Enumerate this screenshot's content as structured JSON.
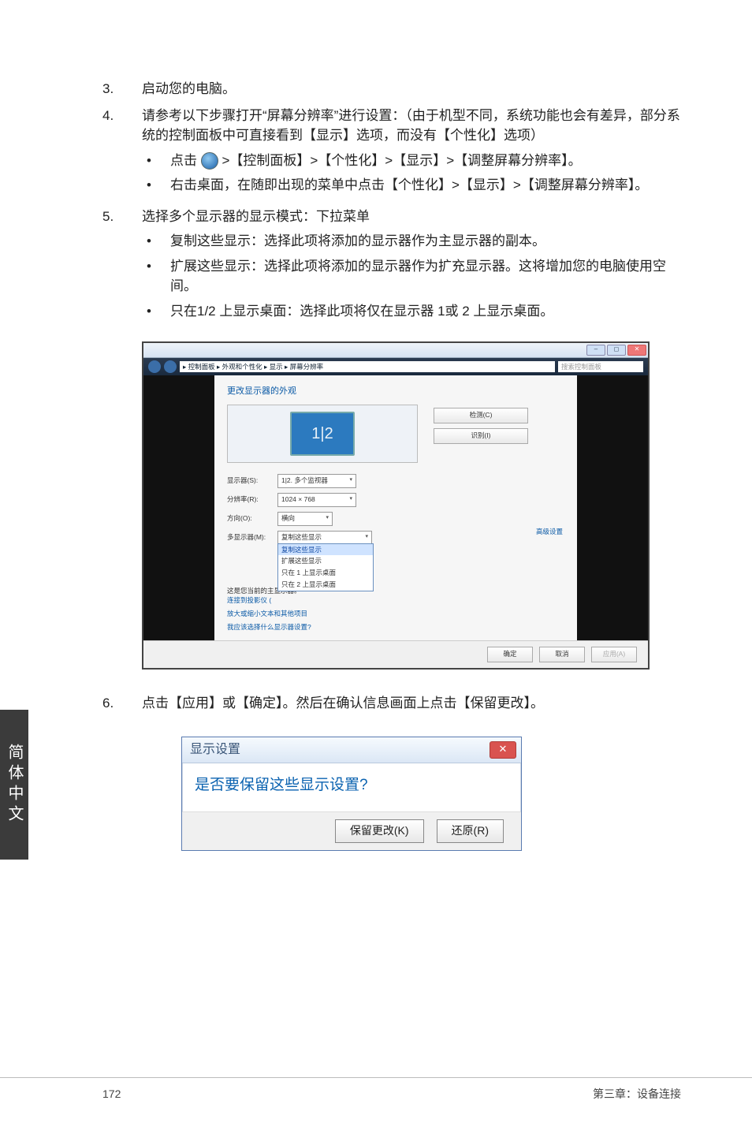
{
  "list": {
    "item3": {
      "num": "3.",
      "text": "启动您的电脑。"
    },
    "item4": {
      "num": "4.",
      "text": "请参考以下步骤打开“屏幕分辨率”进行设置：（由于机型不同，系统功能也会有差异，部分系统的控制面板中可直接看到【显示】选项，而没有【个性化】选项）",
      "sub1_pre": "点击 ",
      "sub1_post": " >【控制面板】>【个性化】>【显示】>【调整屏幕分辨率】。",
      "sub2": "右击桌面，在随即出现的菜单中点击【个性化】>【显示】>【调整屏幕分辨率】。"
    },
    "item5": {
      "num": "5.",
      "text": "选择多个显示器的显示模式：下拉菜单",
      "sub1": "复制这些显示：选择此项将添加的显示器作为主显示器的副本。",
      "sub2": "扩展这些显示：选择此项将添加的显示器作为扩充显示器。这将增加您的电脑使用空间。",
      "sub3": "只在1/2 上显示桌面：选择此项将仅在显示器 1或 2 上显示桌面。"
    },
    "item6": {
      "num": "6.",
      "text": "点击【应用】或【确定】。然后在确认信息画面上点击【保留更改】。"
    }
  },
  "shot1": {
    "breadcrumb": "▸ 控制面板 ▸ 外观和个性化 ▸ 显示 ▸ 屏幕分辨率",
    "search_placeholder": "搜索控制面板",
    "heading": "更改显示器的外观",
    "monitor_label": "1|2",
    "btn_detect": "检测(C)",
    "btn_identify": "识别(I)",
    "label_display": "显示器(S):",
    "val_display": "1|2. 多个监视器",
    "label_res": "分辨率(R):",
    "val_res": "1024 × 768",
    "label_orient": "方向(O):",
    "val_orient": "横向",
    "label_multi": "多显示器(M):",
    "dd_opt1": "复制这些显示",
    "dd_opt2": "扩展这些显示",
    "dd_opt3": "只在 1 上显示桌面",
    "dd_opt4": "只在 2 上显示桌面",
    "note_line1": "这是您当前的主显示器。",
    "note_line2": "连接到投影仪 (",
    "link_text1": "放大或缩小文本和其他项目",
    "link_text2": "我应该选择什么显示器设置?",
    "link_adv": "高级设置",
    "btn_ok": "确定",
    "btn_cancel": "取消",
    "btn_apply": "应用(A)"
  },
  "shot2": {
    "title": "显示设置",
    "question": "是否要保留这些显示设置?",
    "btn_keep": "保留更改(K)",
    "btn_revert": "还原(R)"
  },
  "side_tab": "简体中文",
  "footer": {
    "page": "172",
    "chapter": "第三章：设备连接"
  }
}
